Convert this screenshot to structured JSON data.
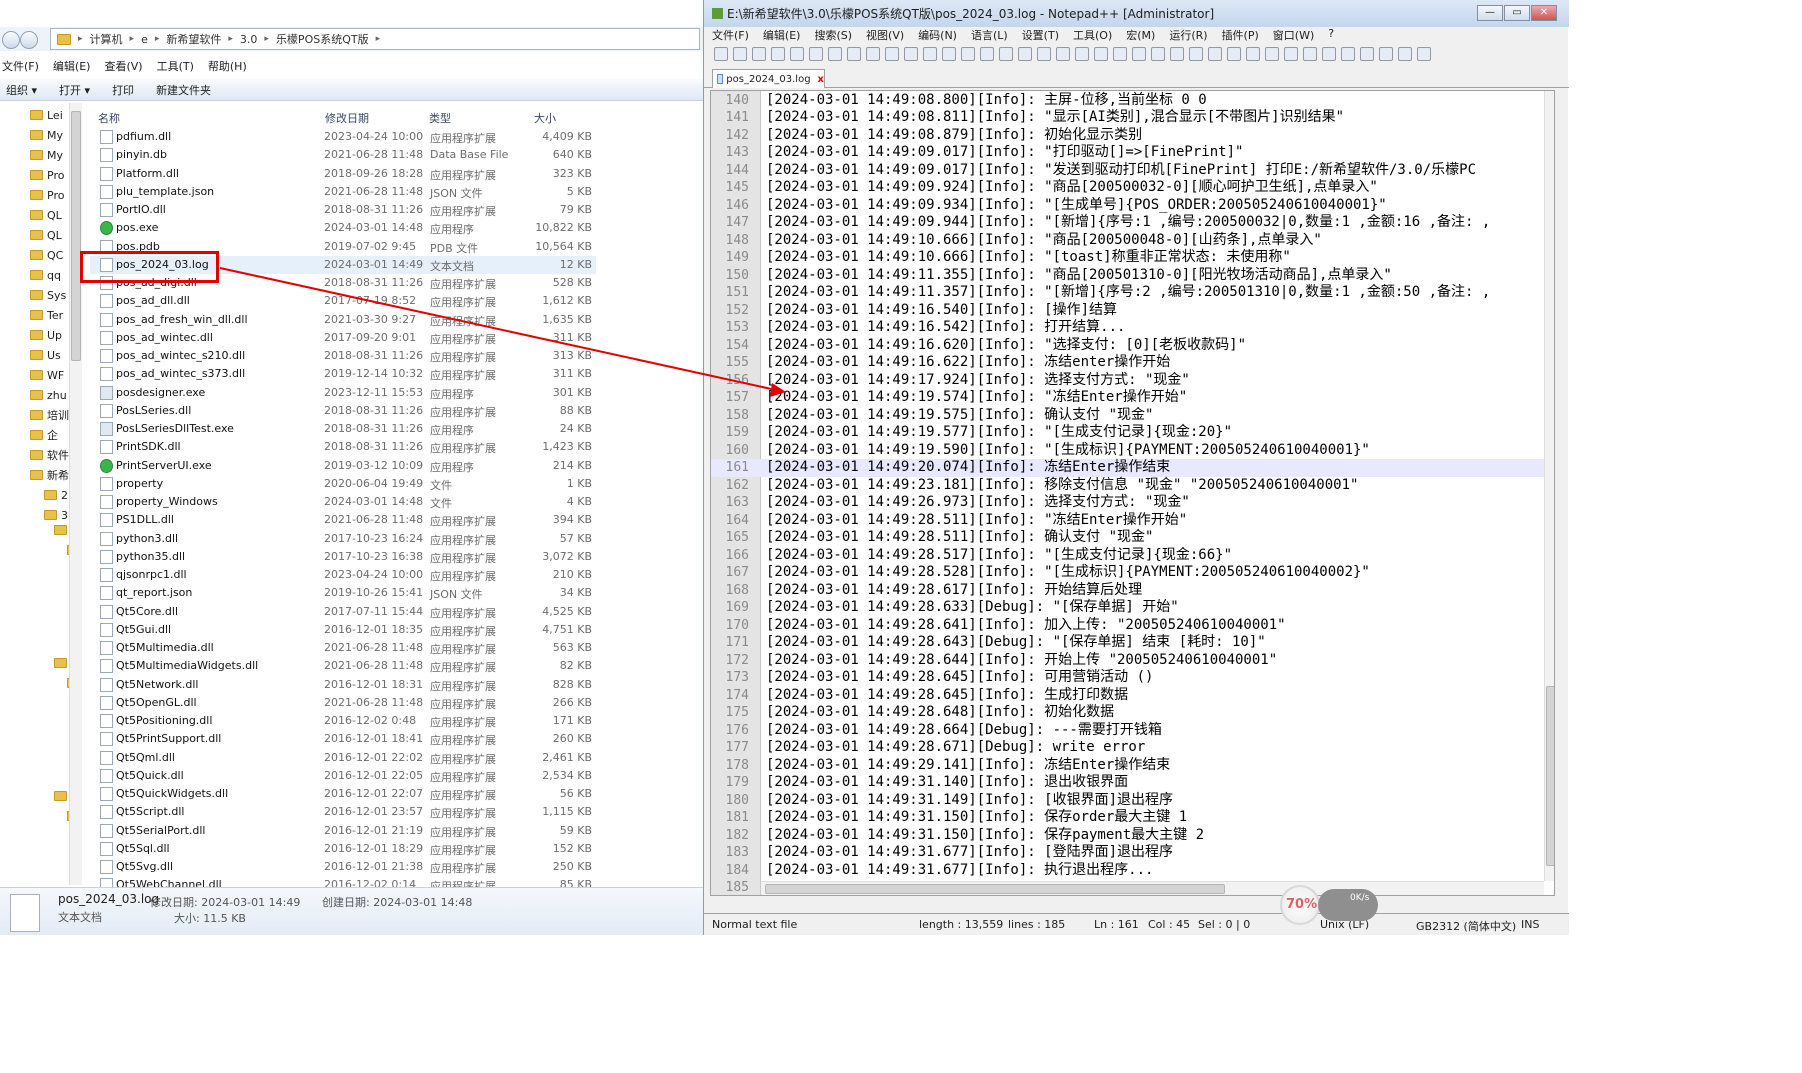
{
  "explorer": {
    "breadcrumb": [
      "计算机",
      "e",
      "新希望软件",
      "3.0",
      "乐檬POS系统QT版"
    ],
    "menu": [
      "文件(F)",
      "编辑(E)",
      "查看(V)",
      "工具(T)",
      "帮助(H)"
    ],
    "toolbar": {
      "organize": "组织 ▾",
      "open": "打开 ▾",
      "print": "打印",
      "new_folder": "新建文件夹"
    },
    "nav_items": [
      "Lei",
      "My",
      "My",
      "Pro",
      "Pro",
      "QL",
      "QL",
      "QC",
      "qq",
      "Sys",
      "Ter",
      "Up",
      "Us",
      "WF",
      "zhu",
      "培训",
      "企",
      "软件",
      "新希",
      "2",
      "3"
    ],
    "columns": {
      "name": "名称",
      "date": "修改日期",
      "type": "类型",
      "size": "大小"
    },
    "files": [
      {
        "name": "pdfium.dll",
        "date": "2023-04-24 10:00",
        "type": "应用程序扩展",
        "size": "4,409 KB"
      },
      {
        "name": "pinyin.db",
        "date": "2021-06-28 11:48",
        "type": "Data Base File",
        "size": "640 KB"
      },
      {
        "name": "Platform.dll",
        "date": "2018-09-26 18:28",
        "type": "应用程序扩展",
        "size": "323 KB"
      },
      {
        "name": "plu_template.json",
        "date": "2021-06-28 11:48",
        "type": "JSON 文件",
        "size": "5 KB"
      },
      {
        "name": "PortIO.dll",
        "date": "2018-08-31 11:26",
        "type": "应用程序扩展",
        "size": "79 KB"
      },
      {
        "name": "pos.exe",
        "date": "2024-03-01 14:48",
        "type": "应用程序",
        "size": "10,822 KB"
      },
      {
        "name": "pos.pdb",
        "date": "2019-07-02 9:45",
        "type": "PDB 文件",
        "size": "10,564 KB"
      },
      {
        "name": "pos_2024_03.log",
        "date": "2024-03-01 14:49",
        "type": "文本文档",
        "size": "12 KB"
      },
      {
        "name": "pos_ad_digi.dll",
        "date": "2018-08-31 11:26",
        "type": "应用程序扩展",
        "size": "528 KB"
      },
      {
        "name": "pos_ad_dll.dll",
        "date": "2017-07-19 8:52",
        "type": "应用程序扩展",
        "size": "1,612 KB"
      },
      {
        "name": "pos_ad_fresh_win_dll.dll",
        "date": "2021-03-30 9:27",
        "type": "应用程序扩展",
        "size": "1,635 KB"
      },
      {
        "name": "pos_ad_wintec.dll",
        "date": "2017-09-20 9:01",
        "type": "应用程序扩展",
        "size": "311 KB"
      },
      {
        "name": "pos_ad_wintec_s210.dll",
        "date": "2018-08-31 11:26",
        "type": "应用程序扩展",
        "size": "313 KB"
      },
      {
        "name": "pos_ad_wintec_s373.dll",
        "date": "2019-12-14 10:32",
        "type": "应用程序扩展",
        "size": "311 KB"
      },
      {
        "name": "posdesigner.exe",
        "date": "2023-12-11 15:53",
        "type": "应用程序",
        "size": "301 KB"
      },
      {
        "name": "PosLSeries.dll",
        "date": "2018-08-31 11:26",
        "type": "应用程序扩展",
        "size": "88 KB"
      },
      {
        "name": "PosLSeriesDllTest.exe",
        "date": "2018-08-31 11:26",
        "type": "应用程序",
        "size": "24 KB"
      },
      {
        "name": "PrintSDK.dll",
        "date": "2018-08-31 11:26",
        "type": "应用程序扩展",
        "size": "1,423 KB"
      },
      {
        "name": "PrintServerUI.exe",
        "date": "2019-03-12 10:09",
        "type": "应用程序",
        "size": "214 KB"
      },
      {
        "name": "property",
        "date": "2020-06-04 19:49",
        "type": "文件",
        "size": "1 KB"
      },
      {
        "name": "property_Windows",
        "date": "2024-03-01 14:48",
        "type": "文件",
        "size": "4 KB"
      },
      {
        "name": "PS1DLL.dll",
        "date": "2021-06-28 11:48",
        "type": "应用程序扩展",
        "size": "394 KB"
      },
      {
        "name": "python3.dll",
        "date": "2017-10-23 16:24",
        "type": "应用程序扩展",
        "size": "57 KB"
      },
      {
        "name": "python35.dll",
        "date": "2017-10-23 16:38",
        "type": "应用程序扩展",
        "size": "3,072 KB"
      },
      {
        "name": "qjsonrpc1.dll",
        "date": "2023-04-24 10:00",
        "type": "应用程序扩展",
        "size": "210 KB"
      },
      {
        "name": "qt_report.json",
        "date": "2019-10-26 15:41",
        "type": "JSON 文件",
        "size": "34 KB"
      },
      {
        "name": "Qt5Core.dll",
        "date": "2017-07-11 15:44",
        "type": "应用程序扩展",
        "size": "4,525 KB"
      },
      {
        "name": "Qt5Gui.dll",
        "date": "2016-12-01 18:35",
        "type": "应用程序扩展",
        "size": "4,751 KB"
      },
      {
        "name": "Qt5Multimedia.dll",
        "date": "2021-06-28 11:48",
        "type": "应用程序扩展",
        "size": "563 KB"
      },
      {
        "name": "Qt5MultimediaWidgets.dll",
        "date": "2021-06-28 11:48",
        "type": "应用程序扩展",
        "size": "82 KB"
      },
      {
        "name": "Qt5Network.dll",
        "date": "2016-12-01 18:31",
        "type": "应用程序扩展",
        "size": "828 KB"
      },
      {
        "name": "Qt5OpenGL.dll",
        "date": "2021-06-28 11:48",
        "type": "应用程序扩展",
        "size": "266 KB"
      },
      {
        "name": "Qt5Positioning.dll",
        "date": "2016-12-02 0:48",
        "type": "应用程序扩展",
        "size": "171 KB"
      },
      {
        "name": "Qt5PrintSupport.dll",
        "date": "2016-12-01 18:41",
        "type": "应用程序扩展",
        "size": "260 KB"
      },
      {
        "name": "Qt5Qml.dll",
        "date": "2016-12-01 22:02",
        "type": "应用程序扩展",
        "size": "2,461 KB"
      },
      {
        "name": "Qt5Quick.dll",
        "date": "2016-12-01 22:05",
        "type": "应用程序扩展",
        "size": "2,534 KB"
      },
      {
        "name": "Qt5QuickWidgets.dll",
        "date": "2016-12-01 22:07",
        "type": "应用程序扩展",
        "size": "56 KB"
      },
      {
        "name": "Qt5Script.dll",
        "date": "2016-12-01 23:57",
        "type": "应用程序扩展",
        "size": "1,115 KB"
      },
      {
        "name": "Qt5SerialPort.dll",
        "date": "2016-12-01 21:19",
        "type": "应用程序扩展",
        "size": "59 KB"
      },
      {
        "name": "Qt5Sql.dll",
        "date": "2016-12-01 18:29",
        "type": "应用程序扩展",
        "size": "152 KB"
      },
      {
        "name": "Qt5Svg.dll",
        "date": "2016-12-01 21:38",
        "type": "应用程序扩展",
        "size": "250 KB"
      },
      {
        "name": "Qt5WebChannel.dll",
        "date": "2016-12-02 0:14",
        "type": "应用程序扩展",
        "size": "85 KB"
      }
    ],
    "selected_index": 7,
    "details": {
      "name": "pos_2024_03.log",
      "modified_label": "修改日期: 2024-03-01 14:49",
      "created_label": "创建日期: 2024-03-01 14:48",
      "type": "文本文档",
      "size_label": "大小: 11.5 KB"
    }
  },
  "npp": {
    "title": "E:\\新希望软件\\3.0\\乐檬POS系统QT版\\pos_2024_03.log - Notepad++ [Administrator]",
    "menu": [
      "文件(F)",
      "编辑(E)",
      "搜索(S)",
      "视图(V)",
      "编码(N)",
      "语言(L)",
      "设置(T)",
      "工具(O)",
      "宏(M)",
      "运行(R)",
      "插件(P)",
      "窗口(W)",
      "?"
    ],
    "tab": "pos_2024_03.log",
    "close_glyph": "x",
    "current_line": 161,
    "lines": [
      {
        "n": "140",
        "t": "[2024-03-01 14:49:08.800][Info]: 主屏-位移,当前坐标 0 0"
      },
      {
        "n": "141",
        "t": "[2024-03-01 14:49:08.811][Info]: \"显示[AI类别],混合显示[不带图片]识别结果\""
      },
      {
        "n": "142",
        "t": "[2024-03-01 14:49:08.879][Info]: 初始化显示类别"
      },
      {
        "n": "143",
        "t": "[2024-03-01 14:49:09.017][Info]: \"打印驱动[]=>[FinePrint]\""
      },
      {
        "n": "144",
        "t": "[2024-03-01 14:49:09.017][Info]: \"发送到驱动打印机[FinePrint] 打印E:/新希望软件/3.0/乐檬PC"
      },
      {
        "n": "145",
        "t": "[2024-03-01 14:49:09.924][Info]: \"商品[200500032-0][顺心呵护卫生纸],点单录入\""
      },
      {
        "n": "146",
        "t": "[2024-03-01 14:49:09.934][Info]: \"[生成单号]{POS_ORDER:200505240610040001}\""
      },
      {
        "n": "147",
        "t": "[2024-03-01 14:49:09.944][Info]: \"[新增]{序号:1 ,编号:200500032|0,数量:1 ,金额:16 ,备注: ,"
      },
      {
        "n": "148",
        "t": "[2024-03-01 14:49:10.666][Info]: \"商品[200500048-0][山药条],点单录入\""
      },
      {
        "n": "149",
        "t": "[2024-03-01 14:49:10.666][Info]: \"[toast]称重非正常状态: 未使用称\""
      },
      {
        "n": "150",
        "t": "[2024-03-01 14:49:11.355][Info]: \"商品[200501310-0][阳光牧场活动商品],点单录入\""
      },
      {
        "n": "151",
        "t": "[2024-03-01 14:49:11.357][Info]: \"[新增]{序号:2 ,编号:200501310|0,数量:1 ,金额:50 ,备注: ,"
      },
      {
        "n": "152",
        "t": "[2024-03-01 14:49:16.540][Info]: [操作]结算"
      },
      {
        "n": "153",
        "t": "[2024-03-01 14:49:16.542][Info]: 打开结算..."
      },
      {
        "n": "154",
        "t": "[2024-03-01 14:49:16.620][Info]: \"选择支付: [0][老板收款码]\""
      },
      {
        "n": "155",
        "t": "[2024-03-01 14:49:16.622][Info]: 冻结enter操作开始"
      },
      {
        "n": "156",
        "t": "[2024-03-01 14:49:17.924][Info]: 选择支付方式: \"现金\""
      },
      {
        "n": "157",
        "t": "[2024-03-01 14:49:19.574][Info]: \"冻结Enter操作开始\""
      },
      {
        "n": "158",
        "t": "[2024-03-01 14:49:19.575][Info]: 确认支付 \"现金\""
      },
      {
        "n": "159",
        "t": "[2024-03-01 14:49:19.577][Info]: \"[生成支付记录]{现金:20}\""
      },
      {
        "n": "160",
        "t": "[2024-03-01 14:49:19.590][Info]: \"[生成标识]{PAYMENT:200505240610040001}\""
      },
      {
        "n": "161",
        "t": "[2024-03-01 14:49:20.074][Info]: 冻结Enter操作结束"
      },
      {
        "n": "162",
        "t": "[2024-03-01 14:49:23.181][Info]: 移除支付信息 \"现金\" \"200505240610040001\""
      },
      {
        "n": "163",
        "t": "[2024-03-01 14:49:26.973][Info]: 选择支付方式: \"现金\""
      },
      {
        "n": "164",
        "t": "[2024-03-01 14:49:28.511][Info]: \"冻结Enter操作开始\""
      },
      {
        "n": "165",
        "t": "[2024-03-01 14:49:28.511][Info]: 确认支付 \"现金\""
      },
      {
        "n": "166",
        "t": "[2024-03-01 14:49:28.517][Info]: \"[生成支付记录]{现金:66}\""
      },
      {
        "n": "167",
        "t": "[2024-03-01 14:49:28.528][Info]: \"[生成标识]{PAYMENT:200505240610040002}\""
      },
      {
        "n": "168",
        "t": "[2024-03-01 14:49:28.617][Info]: 开始结算后处理"
      },
      {
        "n": "169",
        "t": "[2024-03-01 14:49:28.633][Debug]: \"[保存单据] 开始\""
      },
      {
        "n": "170",
        "t": "[2024-03-01 14:49:28.641][Info]: 加入上传: \"200505240610040001\""
      },
      {
        "n": "171",
        "t": "[2024-03-01 14:49:28.643][Debug]: \"[保存单据] 结束 [耗时: 10]\""
      },
      {
        "n": "172",
        "t": "[2024-03-01 14:49:28.644][Info]: 开始上传 \"200505240610040001\""
      },
      {
        "n": "173",
        "t": "[2024-03-01 14:49:28.645][Info]: 可用营销活动 ()"
      },
      {
        "n": "174",
        "t": "[2024-03-01 14:49:28.645][Info]: 生成打印数据"
      },
      {
        "n": "175",
        "t": "[2024-03-01 14:49:28.648][Info]: 初始化数据"
      },
      {
        "n": "176",
        "t": "[2024-03-01 14:49:28.664][Debug]: ---需要打开钱箱"
      },
      {
        "n": "177",
        "t": "[2024-03-01 14:49:28.671][Debug]: write error"
      },
      {
        "n": "178",
        "t": "[2024-03-01 14:49:29.141][Info]: 冻结Enter操作结束"
      },
      {
        "n": "179",
        "t": "[2024-03-01 14:49:31.140][Info]: 退出收银界面"
      },
      {
        "n": "180",
        "t": "[2024-03-01 14:49:31.149][Info]: [收银界面]退出程序"
      },
      {
        "n": "181",
        "t": "[2024-03-01 14:49:31.150][Info]: 保存order最大主键 1"
      },
      {
        "n": "182",
        "t": "[2024-03-01 14:49:31.150][Info]: 保存payment最大主键 2"
      },
      {
        "n": "183",
        "t": "[2024-03-01 14:49:31.677][Info]: [登陆界面]退出程序"
      },
      {
        "n": "184",
        "t": "[2024-03-01 14:49:31.677][Info]: 执行退出程序..."
      },
      {
        "n": "185",
        "t": ""
      }
    ],
    "status": {
      "type": "Normal text file",
      "length": "length : 13,559",
      "lines": "lines : 185",
      "ln": "Ln : 161",
      "col": "Col : 45",
      "sel": "Sel : 0 | 0",
      "eol": "Unix (LF)",
      "encoding": "GB2312 (简体中文)",
      "mode": "INS"
    },
    "overlay": {
      "percent": "70%",
      "speed": "0K/s"
    }
  },
  "colors": {
    "highlight_box": "#e40000",
    "arrow": "#e40000",
    "current_line": "#e8e8ff"
  }
}
